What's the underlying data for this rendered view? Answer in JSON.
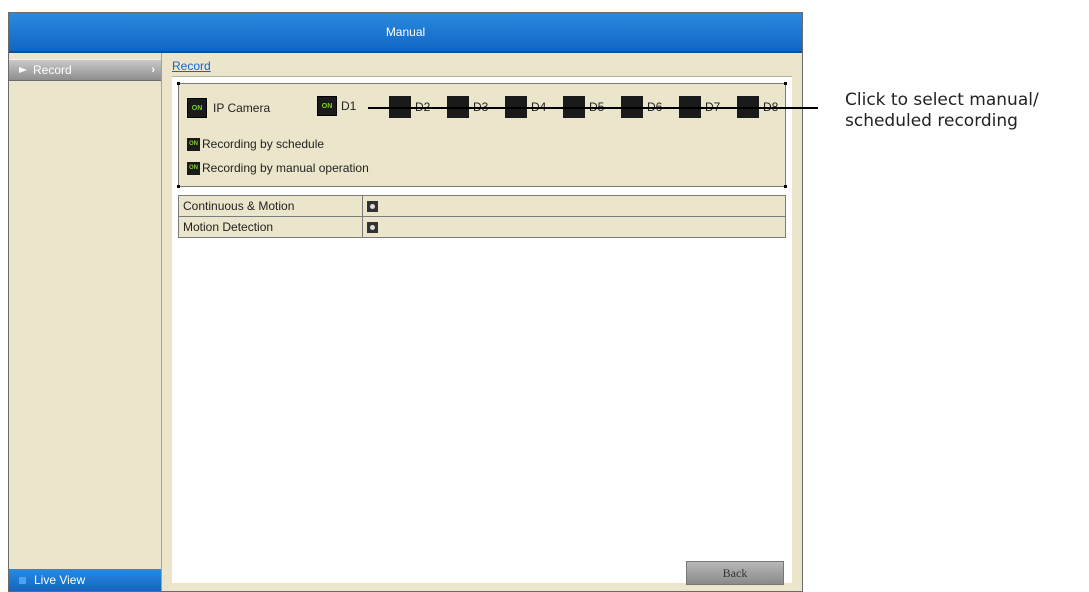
{
  "window": {
    "title": "Manual"
  },
  "sidebar": {
    "items": [
      {
        "label": "Record"
      },
      {
        "label": "Live View"
      }
    ]
  },
  "main": {
    "tab": "Record",
    "mode": {
      "ip_camera_badge": "ON",
      "ip_camera_label": "IP Camera",
      "channels": [
        {
          "badge": "ON",
          "label": "D1",
          "state": "on"
        },
        {
          "label": "D2",
          "state": "off"
        },
        {
          "label": "D3",
          "state": "off"
        },
        {
          "label": "D4",
          "state": "off"
        },
        {
          "label": "D5",
          "state": "off"
        },
        {
          "label": "D6",
          "state": "off"
        },
        {
          "label": "D7",
          "state": "off"
        },
        {
          "label": "D8",
          "state": "off"
        }
      ],
      "options": [
        {
          "badge": "ON",
          "label": "Recording by schedule"
        },
        {
          "badge": "ON",
          "label": "Recording by manual operation"
        }
      ]
    },
    "record_types": [
      {
        "label": "Continuous & Motion"
      },
      {
        "label": "Motion Detection"
      }
    ],
    "back_label": "Back"
  },
  "annotation": {
    "line1": "Click to select manual/",
    "line2": "scheduled recording"
  },
  "colors": {
    "title_blue": "#1a73d0",
    "panel_beige": "#ebe5cb",
    "on_green": "#7ed321"
  }
}
